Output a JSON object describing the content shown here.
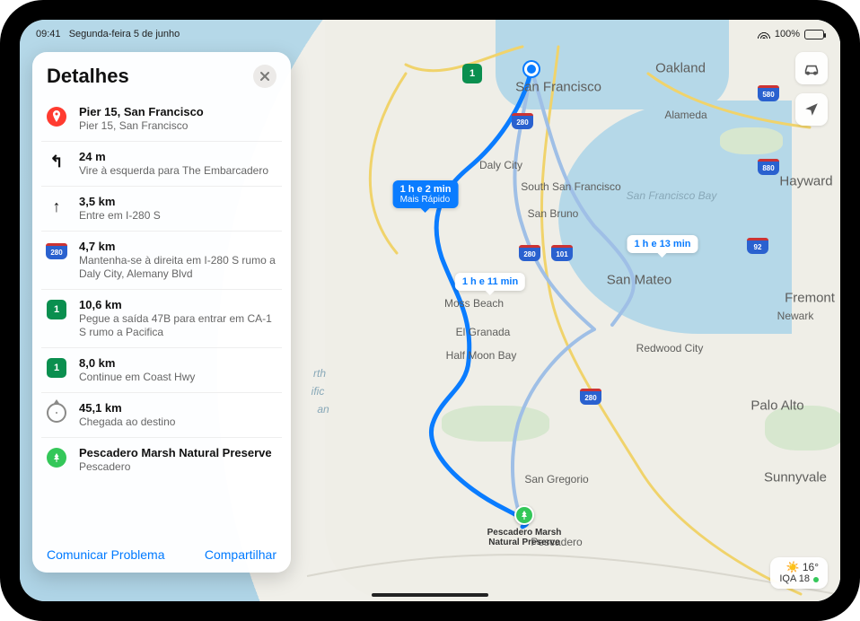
{
  "status": {
    "time": "09:41",
    "date": "Segunda-feira 5 de junho",
    "battery": "100%"
  },
  "card": {
    "title": "Detalhes",
    "footer": {
      "report": "Comunicar Problema",
      "share": "Compartilhar"
    }
  },
  "steps": [
    {
      "icon": "pin-red",
      "dist": "Pier 15, San Francisco",
      "desc": "Pier 15, San Francisco"
    },
    {
      "icon": "turn-left",
      "dist": "24 m",
      "desc": "Vire à esquerda para The Embarcadero"
    },
    {
      "icon": "straight",
      "dist": "3,5 km",
      "desc": "Entre em I-280 S"
    },
    {
      "icon": "shield-280",
      "dist": "4,7 km",
      "desc": "Mantenha-se à direita em I-280 S rumo a Daly City, Alemany Blvd"
    },
    {
      "icon": "shield-1",
      "dist": "10,6 km",
      "desc": "Pegue a saída 47B para entrar em CA-1 S rumo a Pacifica"
    },
    {
      "icon": "shield-1",
      "dist": "8,0 km",
      "desc": "Continue em Coast Hwy"
    },
    {
      "icon": "arrive",
      "dist": "45,1 km",
      "desc": "Chegada ao destino"
    },
    {
      "icon": "park-green",
      "dist": "Pescadero Marsh Natural Preserve",
      "desc": "Pescadero"
    }
  ],
  "routes": {
    "primary": {
      "time": "1 h e 2 min",
      "sub": "Mais Rápido"
    },
    "alt1": {
      "time": "1 h e 11 min"
    },
    "alt2": {
      "time": "1 h e 13 min"
    }
  },
  "weather": {
    "temp": "16°",
    "aqi_label": "IQA 18"
  },
  "destination_label": "Pescadero Marsh\nNatural Preserve",
  "map_labels": {
    "sf": "San Francisco",
    "oakland": "Oakland",
    "alameda": "Alameda",
    "dalycity": "Daly City",
    "southsf": "South San Francisco",
    "sanbruno": "San Bruno",
    "sanmateo": "San Mateo",
    "hayward": "Hayward",
    "fremont": "Fremont",
    "paloalto": "Palo Alto",
    "sunnyvale": "Sunnyvale",
    "redwood": "Redwood City",
    "halfmoon": "Half Moon Bay",
    "mossbeach": "Moss Beach",
    "elgranada": "El Granada",
    "sangregorio": "San Gregorio",
    "pescadero": "Pescadero",
    "newark": "Newark",
    "sf_bay": "San Francisco Bay",
    "pacific1": "rth",
    "pacific2": "ific",
    "pacific3": "an"
  }
}
